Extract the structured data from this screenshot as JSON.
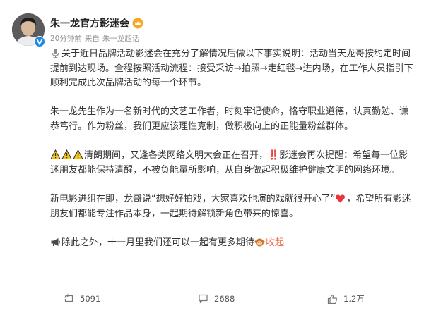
{
  "post": {
    "author_name": "朱一龙官方影迷会",
    "time": "20分钟前",
    "source_prefix": "来自",
    "source": "朱一龙超话",
    "p1": "关于近日品牌活动影迷会在充分了解情况后做以下事实说明：活动当天龙哥按约定时间提前到达现场。全程按照活动流程：接受采访→拍照→走红毯→进内场，在工作人员指引下顺利完成此次品牌活动的每一个环节。",
    "p2": "朱一龙先生作为一名新时代的文艺工作者，时刻牢记使命，恪守职业道德，认真勤勉、谦恭笃行。作为粉丝，我们更应该理性克制，做积极向上的正能量粉丝群体。",
    "p3": "清朗期间，又逢各类网络文明大会正在召开，‼️影迷会再次提醒：希望每一位影迷朋友都能保持清醒，不被负能量所影响，从自身做起积极维护健康文明的网络环境。",
    "p4_a": "新电影进组在即，龙哥说“想好好拍戏，大家喜欢他演的戏就很开心了”",
    "p4_b": "，希望所有影迷朋友们都能专注作品本身，一起期待解锁新角色带来的惊喜。",
    "p5": "除此之外，十一月里我们还可以一起有更多期待",
    "collapse": "收起"
  },
  "actions": {
    "repost_count": "5091",
    "comment_count": "2688",
    "like_count": "1.2万"
  },
  "icons": [
    "avatar",
    "verified-badge-icon",
    "crown-icon",
    "microphone-icon",
    "warning-icon",
    "heart-icon",
    "megaphone-icon",
    "monkey-icon",
    "repost-icon",
    "comment-icon",
    "like-icon"
  ],
  "colors": {
    "accent": "#eb7350",
    "verified": "#f6a623",
    "text": "#333333",
    "meta": "#939393"
  }
}
